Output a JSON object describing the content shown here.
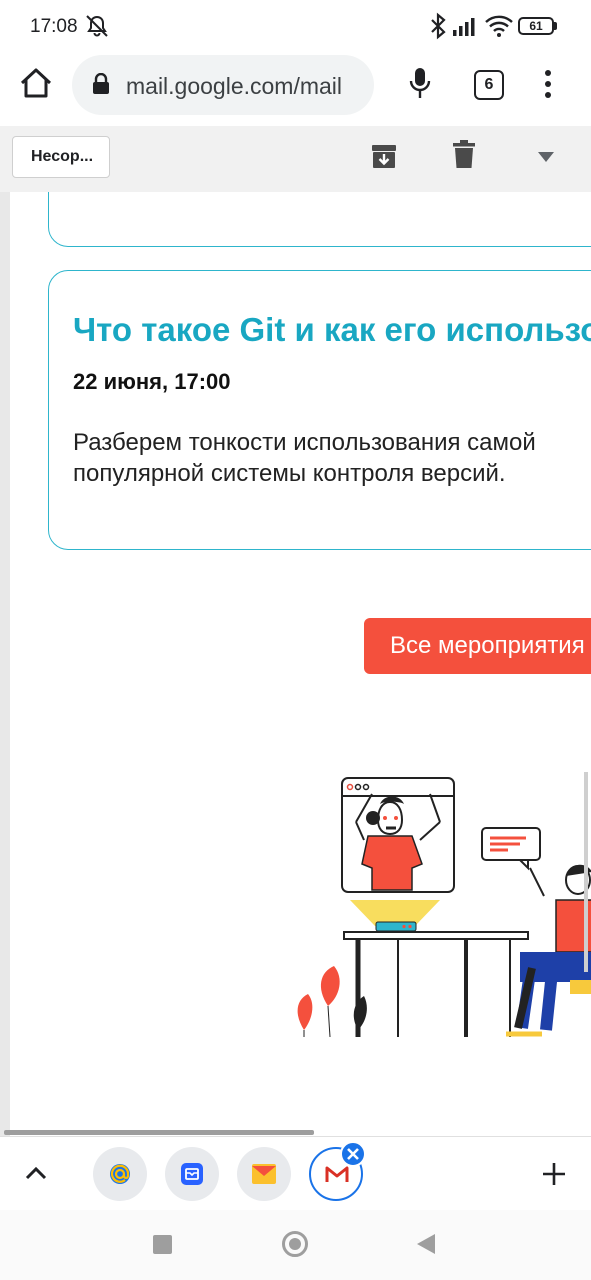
{
  "status_bar": {
    "time": "17:08",
    "battery": "61"
  },
  "browser": {
    "url": "mail.google.com/mail",
    "tab_count": "6"
  },
  "toolbar": {
    "back_label": "Несор..."
  },
  "event_card": {
    "title": "Что такое Git и как его использовать",
    "date": "22 июня, 17:00",
    "description": "Разберем тонкости использования самой популярной системы контроля версий."
  },
  "events_button": {
    "label": "Все мероприятия"
  },
  "colors": {
    "accent_cyan": "#19a7c2",
    "button_red": "#f4503d",
    "chrome_blue": "#1a73e8"
  },
  "icons": {
    "home": "home-icon",
    "lock": "lock-icon",
    "mic": "mic-icon",
    "menu": "more-vert-icon",
    "archive": "archive-icon",
    "delete": "trash-icon",
    "dropdown": "caret-down-icon"
  }
}
